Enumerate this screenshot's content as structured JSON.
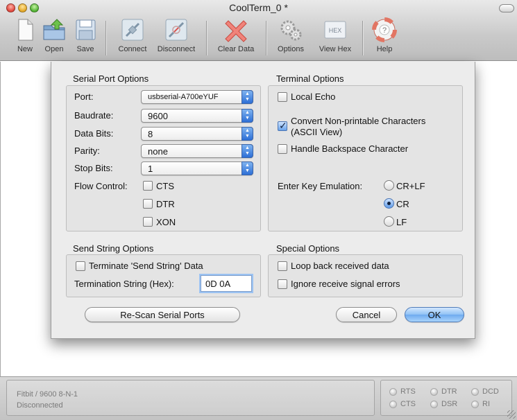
{
  "window": {
    "title": "CoolTerm_0 *"
  },
  "toolbar": {
    "items": [
      {
        "label": "New",
        "icon": "new-document-icon"
      },
      {
        "label": "Open",
        "icon": "open-folder-icon"
      },
      {
        "label": "Save",
        "icon": "save-disk-icon"
      },
      {
        "label": "Connect",
        "icon": "connect-plug-icon"
      },
      {
        "label": "Disconnect",
        "icon": "disconnect-plug-icon"
      },
      {
        "label": "Clear Data",
        "icon": "clear-x-icon"
      },
      {
        "label": "Options",
        "icon": "options-gears-icon"
      },
      {
        "label": "View Hex",
        "icon": "hex-icon",
        "badge": "HEX"
      },
      {
        "label": "Help",
        "icon": "help-lifebuoy-icon"
      }
    ]
  },
  "serial_port_options": {
    "title": "Serial Port Options",
    "port_label": "Port:",
    "port_value": "usbserial-A700eYUF",
    "baudrate_label": "Baudrate:",
    "baudrate_value": "9600",
    "databits_label": "Data Bits:",
    "databits_value": "8",
    "parity_label": "Parity:",
    "parity_value": "none",
    "stopbits_label": "Stop Bits:",
    "stopbits_value": "1",
    "flow_control_label": "Flow Control:",
    "flow_cts": "CTS",
    "flow_dtr": "DTR",
    "flow_xon": "XON"
  },
  "terminal_options": {
    "title": "Terminal Options",
    "local_echo": "Local Echo",
    "convert_line1": "Convert Non-printable Characters",
    "convert_line2": "(ASCII View)",
    "handle_backspace": "Handle Backspace Character",
    "enter_key_label": "Enter Key Emulation:",
    "crlf": "CR+LF",
    "cr": "CR",
    "lf": "LF"
  },
  "send_string_options": {
    "title": "Send String Options",
    "terminate": "Terminate 'Send String' Data",
    "termination_label": "Termination String (Hex):",
    "termination_value": "0D 0A"
  },
  "special_options": {
    "title": "Special Options",
    "loop_back": "Loop back received data",
    "ignore_errors": "Ignore receive signal errors"
  },
  "buttons": {
    "rescan": "Re-Scan Serial Ports",
    "cancel": "Cancel",
    "ok": "OK"
  },
  "status": {
    "line1": "Fitbit / 9600 8-N-1",
    "line2": "Disconnected",
    "rts": "RTS",
    "dtr": "DTR",
    "dcd": "DCD",
    "cts": "CTS",
    "dsr": "DSR",
    "ri": "RI"
  }
}
